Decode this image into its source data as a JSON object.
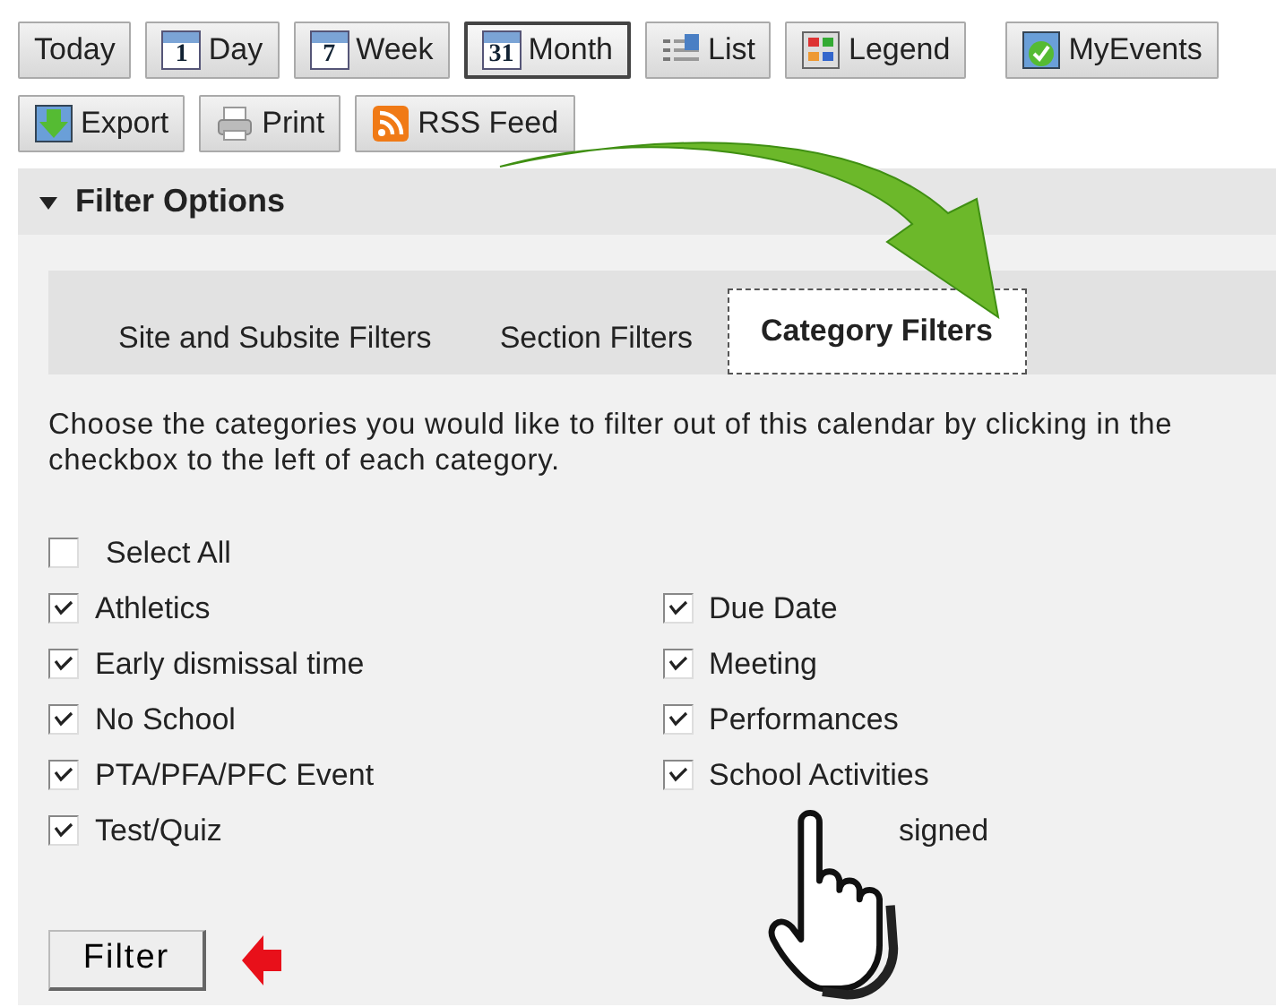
{
  "toolbar": [
    [
      {
        "label": "Today",
        "selected": false
      },
      {
        "label": "Day",
        "icon_text": "1",
        "selected": false
      },
      {
        "label": "Week",
        "icon_text": "7",
        "selected": false
      },
      {
        "label": "Month",
        "icon_text": "31",
        "selected": true
      },
      {
        "label": "List",
        "selected": false
      },
      {
        "label": "Legend",
        "selected": false
      },
      {
        "label": "MyEvents",
        "selected": false
      }
    ],
    [
      {
        "label": "Export",
        "selected": false
      },
      {
        "label": "Print",
        "selected": false
      },
      {
        "label": "RSS Feed",
        "selected": false
      }
    ]
  ],
  "filter_options": {
    "title": "Filter Options",
    "expanded": true
  },
  "tabs": [
    {
      "label": "Site and Subsite Filters",
      "selected": false
    },
    {
      "label": "Section Filters",
      "selected": false
    },
    {
      "label": "Category Filters",
      "selected": true
    }
  ],
  "description": "Choose the categories you would like to filter out of this calendar by clicking in the checkbox to the left of each category.",
  "select_all": {
    "label": "Select All",
    "checked": false
  },
  "categories": [
    [
      {
        "label": "Athletics",
        "checked": true
      },
      {
        "label": "Early dismissal time",
        "checked": true
      },
      {
        "label": "No School",
        "checked": true
      },
      {
        "label": "PTA/PFA/PFC Event",
        "checked": true
      },
      {
        "label": "Test/Quiz",
        "checked": true
      }
    ],
    [
      {
        "label": "Due Date",
        "checked": true
      },
      {
        "label": "Meeting",
        "checked": true
      },
      {
        "label": "Performances",
        "checked": true
      },
      {
        "label": "School Activities",
        "checked": true
      },
      {
        "label": "signed",
        "kind": "covered"
      }
    ]
  ],
  "filter_button": "Filter"
}
